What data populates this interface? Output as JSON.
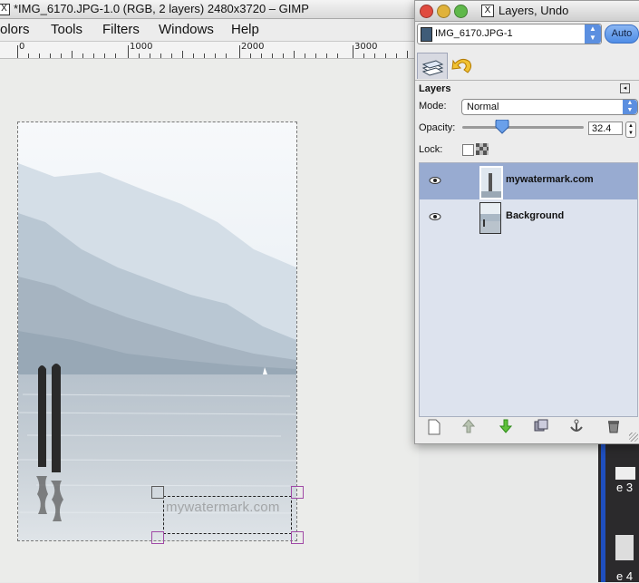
{
  "main_window": {
    "title": "*IMG_6170.JPG-1.0 (RGB, 2 layers) 2480x3720 – GIMP",
    "menu": [
      {
        "label": "olors"
      },
      {
        "label": "Tools"
      },
      {
        "label": "Filters"
      },
      {
        "label": "Windows"
      },
      {
        "label": "Help"
      }
    ],
    "ruler_labels": [
      "0",
      "1000",
      "2000",
      "3000"
    ],
    "watermark_text": "mywatermark.com"
  },
  "layers_dialog": {
    "title": "Layers, Undo",
    "image_selector": "IMG_6170.JPG-1",
    "auto_button": "Auto",
    "panel_heading": "Layers",
    "mode_label": "Mode:",
    "mode_value": "Normal",
    "opacity_label": "Opacity:",
    "opacity_value": "32.4",
    "opacity_fraction": 0.324,
    "lock_label": "Lock:",
    "layers": [
      {
        "name": "mywatermark.com",
        "selected": true
      },
      {
        "name": "Background",
        "selected": false
      }
    ],
    "bottom_buttons": [
      "new-layer",
      "raise-layer",
      "lower-layer",
      "duplicate-layer",
      "anchor-layer",
      "delete-layer"
    ]
  },
  "background_window": {
    "text_1": "e 3",
    "text_2": "e 4"
  },
  "colors": {
    "selection": "#98abd1",
    "list_background": "#dde3ee",
    "accent_blue": "#5b8fe0",
    "handle_gray": "#5c5c5c",
    "handle_purple": "#a04aa6"
  }
}
